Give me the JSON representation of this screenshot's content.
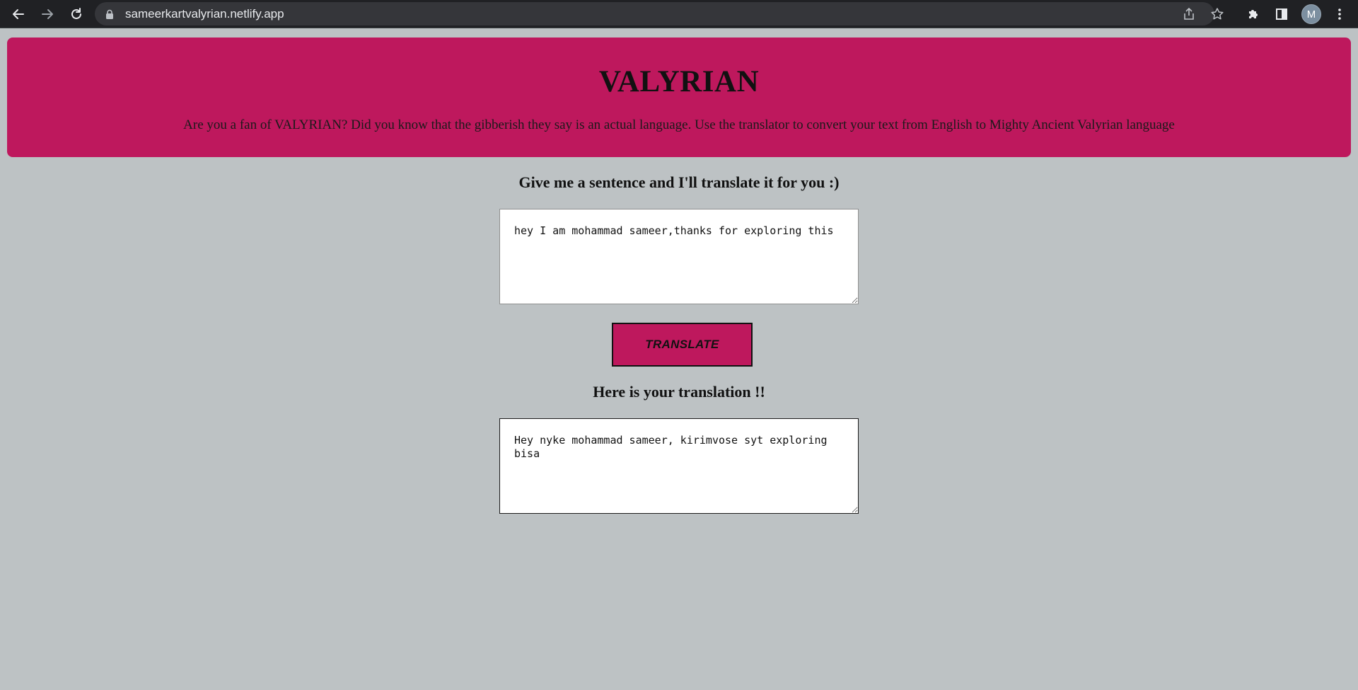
{
  "browser": {
    "url": "sameerkartvalyrian.netlify.app",
    "profile_initial": "M",
    "icons": {
      "back": "back-arrow-icon",
      "forward": "forward-arrow-icon",
      "reload": "reload-icon",
      "lock": "lock-icon",
      "share": "share-icon",
      "bookmark": "star-icon",
      "extensions": "puzzle-icon",
      "side_panel": "side-panel-icon",
      "menu": "kebab-menu-icon"
    }
  },
  "header": {
    "title": "VALYRIAN",
    "description": "Are you a fan of VALYRIAN? Did you know that the gibberish they say is an actual language. Use the translator to convert your text from English to Mighty Ancient Valyrian language"
  },
  "input_section": {
    "heading": "Give me a sentence and I'll translate it for you :)",
    "value": "hey I am mohammad sameer,thanks for exploring this"
  },
  "translate_button": {
    "label": "TRANSLATE"
  },
  "output_section": {
    "heading": "Here is your translation !!",
    "value": "Hey nyke mohammad sameer, kirimvose syt exploring bisa"
  },
  "colors": {
    "page_background": "#bdc2c4",
    "accent": "#be185d",
    "chrome_background": "#202124"
  }
}
